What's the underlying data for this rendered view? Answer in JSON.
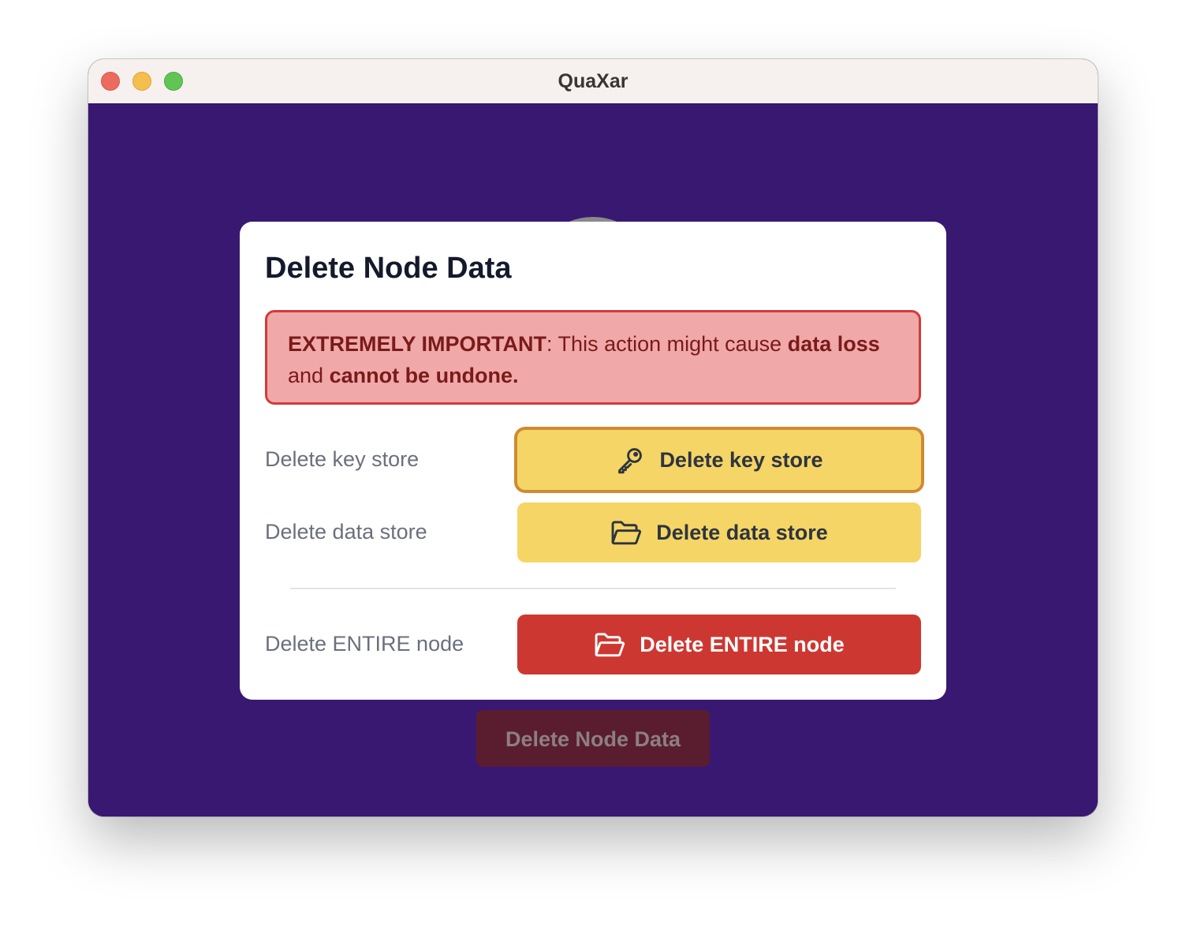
{
  "window": {
    "title": "QuaXar"
  },
  "background": {
    "button_label": "Delete Node Data"
  },
  "modal": {
    "title": "Delete Node Data",
    "alert": {
      "strong_prefix": "EXTREMELY IMPORTANT",
      "text_1": ": This action might cause ",
      "strong_1": "data loss",
      "text_2": " and ",
      "strong_2": "cannot be undone."
    },
    "rows": [
      {
        "label": "Delete key store",
        "button_label": "Delete key store",
        "icon": "key-icon"
      },
      {
        "label": "Delete data store",
        "button_label": "Delete data store",
        "icon": "folder-open-icon"
      },
      {
        "label": "Delete ENTIRE node",
        "button_label": "Delete ENTIRE node",
        "icon": "folder-open-icon"
      }
    ]
  },
  "colors": {
    "background": "#391872",
    "warning_button": "#f5d565",
    "danger_button": "#cc3831",
    "alert_background": "#f0a8a8",
    "alert_border": "#d23b3b"
  }
}
